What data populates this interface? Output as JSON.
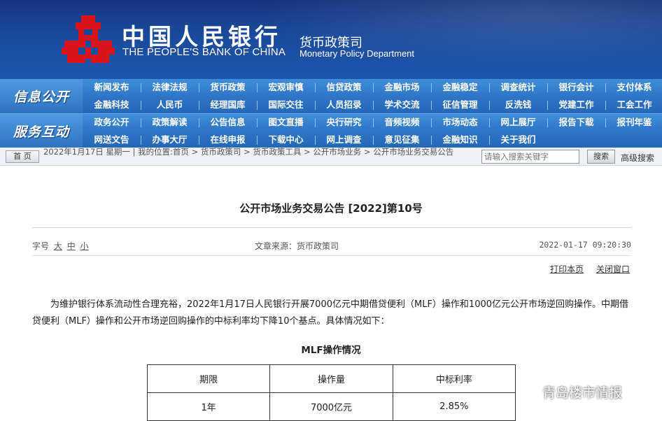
{
  "header": {
    "bank_name_cn": "中国人民银行",
    "bank_name_en": "THE PEOPLE'S BANK OF CHINA",
    "dept_cn": "货币政策司",
    "dept_en": "Monetary Policy Department",
    "logo_color": "#d7141a"
  },
  "nav": {
    "categories": [
      "信息公开",
      "服务互动"
    ],
    "rows": [
      [
        "新闻发布",
        "法律法规",
        "货币政策",
        "宏观审慎",
        "信贷政策",
        "金融市场",
        "金融稳定",
        "调查统计",
        "银行会计",
        "支付体系"
      ],
      [
        "金融科技",
        "人民币",
        "经理国库",
        "国际交往",
        "人员招录",
        "学术交流",
        "征信管理",
        "反洗钱",
        "党建工作",
        "工会工作"
      ],
      [
        "政务公开",
        "政策解读",
        "公告信息",
        "图文直播",
        "央行研究",
        "音频视频",
        "市场动态",
        "网上展厅",
        "报告下载",
        "报刊年鉴"
      ],
      [
        "网送文告",
        "办事大厅",
        "在线申报",
        "下载中心",
        "网上调查",
        "意见征集",
        "金融知识",
        "关于我们"
      ]
    ]
  },
  "breadcrumb": {
    "home_label": "首 页",
    "text": "2022年1月17日 星期一 | 我的位置:首页 > 货币政策司 > 货币政策工具 > 公开市场业务 > 公开市场业务交易公告",
    "search_placeholder": "请输入搜索关键字",
    "search_button": "搜索",
    "advanced_search": "高级搜索"
  },
  "article": {
    "title": "公开市场业务交易公告 [2022]第10号",
    "font_size_label": "字号",
    "font_sizes": [
      "大",
      "中",
      "小"
    ],
    "source": "文章来源：货币政策司",
    "date": "2022-01-17 09:20:30",
    "print_label": "打印本页",
    "close_label": "关闭窗口",
    "paragraph": "为维护银行体系流动性合理充裕，2022年1月17日人民银行开展7000亿元中期借贷便利（MLF）操作和1000亿元公开市场逆回购操作。中期借贷便利（MLF）操作和公开市场逆回购操作的中标利率均下降10个基点。具体情况如下：",
    "table_title": "MLF操作情况",
    "table_headers": [
      "期限",
      "操作量",
      "中标利率"
    ],
    "table_rows": [
      [
        "1年",
        "7000亿元",
        "2.85%"
      ]
    ]
  },
  "watermark": {
    "text": "青岛楼市情报"
  }
}
